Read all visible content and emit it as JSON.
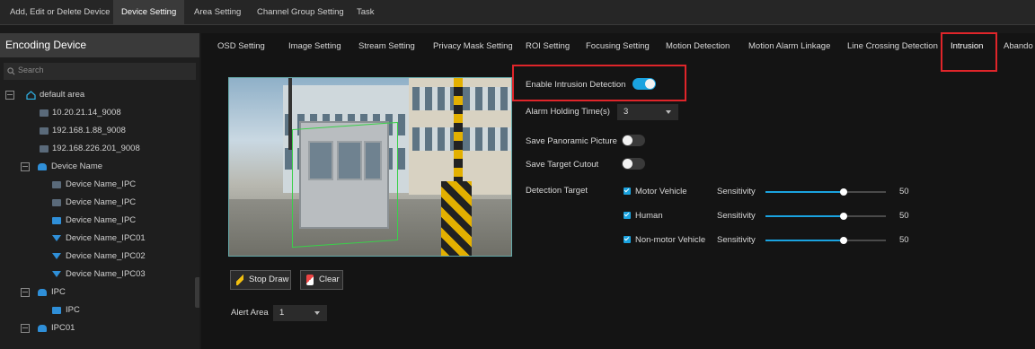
{
  "top_tabs": [
    {
      "label": "Add, Edit or Delete Device"
    },
    {
      "label": "Device Setting"
    },
    {
      "label": "Area Setting"
    },
    {
      "label": "Channel Group Setting"
    },
    {
      "label": "Task"
    }
  ],
  "sidebar": {
    "title": "Encoding Device",
    "search_placeholder": "Search",
    "tree": [
      {
        "label": "default area",
        "icon": "home-icon"
      },
      {
        "label": "10.20.21.14_9008",
        "icon": "device-icon"
      },
      {
        "label": "192.168.1.88_9008",
        "icon": "device-icon"
      },
      {
        "label": "192.168.226.201_9008",
        "icon": "device-icon"
      },
      {
        "label": "Device Name",
        "icon": "group-icon"
      },
      {
        "label": "Device Name_IPC",
        "icon": "device-icon"
      },
      {
        "label": "Device Name_IPC",
        "icon": "device-icon"
      },
      {
        "label": "Device Name_IPC",
        "icon": "ipc-icon"
      },
      {
        "label": "Device Name_IPC01",
        "icon": "ptz-icon"
      },
      {
        "label": "Device Name_IPC02",
        "icon": "ptz-icon"
      },
      {
        "label": "Device Name_IPC03",
        "icon": "ptz-icon"
      },
      {
        "label": "IPC",
        "icon": "group-icon"
      },
      {
        "label": "IPC",
        "icon": "ipc-icon"
      },
      {
        "label": "IPC01",
        "icon": "group-icon"
      }
    ]
  },
  "sub_tabs": [
    {
      "label": "OSD Setting"
    },
    {
      "label": "Image Setting"
    },
    {
      "label": "Stream Setting"
    },
    {
      "label": "Privacy Mask Setting"
    },
    {
      "label": "ROI Setting"
    },
    {
      "label": "Focusing Setting"
    },
    {
      "label": "Motion Detection"
    },
    {
      "label": "Motion Alarm Linkage"
    },
    {
      "label": "Line Crossing Detection"
    },
    {
      "label": "Intrusion"
    },
    {
      "label": "Abando"
    }
  ],
  "buttons": {
    "stop_draw": "Stop Draw",
    "clear": "Clear"
  },
  "alert_area": {
    "label": "Alert Area",
    "value": "1"
  },
  "settings": {
    "enable_label": "Enable Intrusion Detection",
    "enable_on": true,
    "holding_label": "Alarm Holding Time(s)",
    "holding_value": "3",
    "save_panoramic_label": "Save Panoramic Picture",
    "save_panoramic_on": false,
    "save_cutout_label": "Save Target Cutout",
    "save_cutout_on": false,
    "detection_target_label": "Detection Target",
    "targets": [
      {
        "name": "Motor Vehicle",
        "checked": true,
        "sensitivity_label": "Sensitivity",
        "value": "50",
        "level": 50
      },
      {
        "name": "Human",
        "checked": true,
        "sensitivity_label": "Sensitivity",
        "value": "50",
        "level": 50
      },
      {
        "name": "Non-motor Vehicle",
        "checked": true,
        "sensitivity_label": "Sensitivity",
        "value": "50",
        "level": 50
      }
    ]
  },
  "colors": {
    "accent": "#1aa3e0",
    "highlight": "#e0252a"
  }
}
